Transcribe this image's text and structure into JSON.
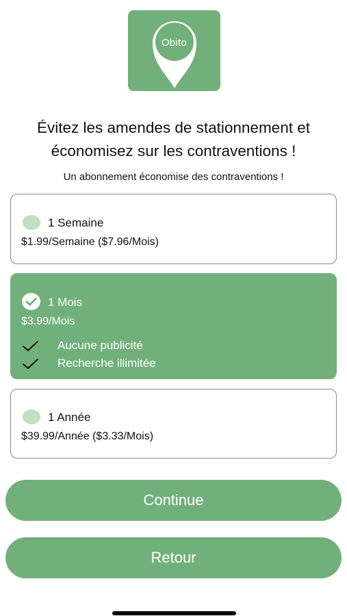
{
  "logo": {
    "text": "Obito",
    "icon": "map-pin-icon",
    "color": "#72b07b"
  },
  "headline": {
    "line1": "Évitez les amendes de stationnement et",
    "line2": "économisez sur les contraventions !"
  },
  "subheadline": "Un abonnement économise des contraventions !",
  "plans": [
    {
      "name": "1 Semaine",
      "price": "$1.99/Semaine ($7.96/Mois)",
      "selected": false
    },
    {
      "name": "1 Mois",
      "price": "$3.99/Mois",
      "selected": true,
      "features": [
        "Aucune publicité",
        "Recherche illimitée"
      ]
    },
    {
      "name": "1 Année",
      "price": "$39.99/Année ($3.33/Mois)",
      "selected": false
    }
  ],
  "buttons": {
    "continue": "Continue",
    "back": "Retour"
  },
  "colors": {
    "accent": "#72b07b",
    "radio_unselected": "#c2dfc6",
    "border": "#8a8a8a"
  }
}
